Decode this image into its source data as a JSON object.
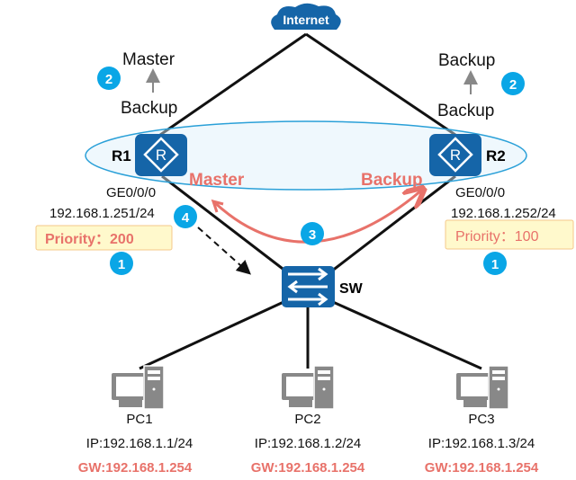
{
  "internet": {
    "label": "Internet"
  },
  "r1": {
    "name": "R1",
    "state_top": "Master",
    "state_bottom": "Backup",
    "role": "Master",
    "interface": "GE0/0/0",
    "ip": "192.168.1.251/24",
    "priority": "Priority：200"
  },
  "r2": {
    "name": "R2",
    "state_top": "Backup",
    "state_bottom": "Backup",
    "role": "Backup",
    "interface": "GE0/0/0",
    "ip": "192.168.1.252/24",
    "priority": "Priority：100"
  },
  "switch": {
    "name": "SW"
  },
  "badges": {
    "one": "1",
    "two": "2",
    "three": "3",
    "four": "4"
  },
  "pcs": [
    {
      "name": "PC1",
      "ip": "IP:192.168.1.1/24",
      "gw": "GW:192.168.1.254"
    },
    {
      "name": "PC2",
      "ip": "IP:192.168.1.2/24",
      "gw": "GW:192.168.1.254"
    },
    {
      "name": "PC3",
      "ip": "IP:192.168.1.3/24",
      "gw": "GW:192.168.1.254"
    }
  ],
  "colors": {
    "device": "#1565a8",
    "accent": "#e8726a",
    "badge": "#0aa6e6",
    "vrrp_group": "#2aa0d8"
  }
}
